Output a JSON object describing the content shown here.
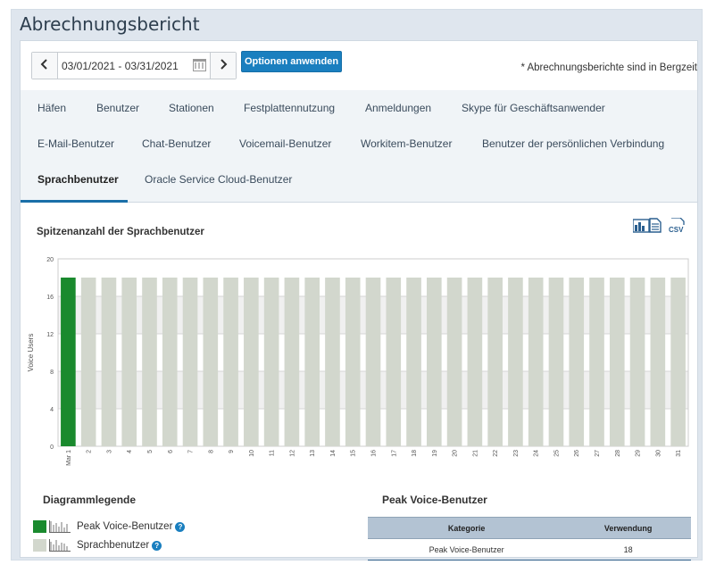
{
  "page": {
    "title": "Abrechnungsbericht"
  },
  "toolbar": {
    "date_range": "03/01/2021 - 03/31/2021",
    "prev_label": "‹",
    "next_label": "›",
    "apply_label": "Optionen anwenden",
    "timezone_note": "* Abrechnungsberichte sind in Bergzeit"
  },
  "tabs": [
    {
      "label": "Häfen"
    },
    {
      "label": "Benutzer"
    },
    {
      "label": "Stationen"
    },
    {
      "label": "Festplattennutzung"
    },
    {
      "label": "Anmeldungen"
    },
    {
      "label": "Skype für Geschäftsanwender"
    },
    {
      "label": "E-Mail-Benutzer"
    },
    {
      "label": "Chat-Benutzer"
    },
    {
      "label": "Voicemail-Benutzer"
    },
    {
      "label": "Workitem-Benutzer"
    },
    {
      "label": "Benutzer der persönlichen Verbindung"
    },
    {
      "label": "Sprachbenutzer",
      "active": true
    },
    {
      "label": "Oracle Service Cloud-Benutzer"
    }
  ],
  "chart_section": {
    "title": "Spitzenanzahl der Sprachbenutzer",
    "export_chart_icon": "chart-report-icon",
    "export_csv_icon": "csv-icon",
    "csv_label": "CSV"
  },
  "chart_data": {
    "type": "bar",
    "ylabel": "Voice Users",
    "ylim": [
      0,
      20
    ],
    "yticks": [
      0,
      4,
      8,
      12,
      16,
      20
    ],
    "categories": [
      "Mar 1",
      "2",
      "3",
      "4",
      "5",
      "6",
      "7",
      "8",
      "9",
      "10",
      "11",
      "12",
      "13",
      "14",
      "15",
      "16",
      "17",
      "18",
      "19",
      "20",
      "21",
      "22",
      "23",
      "24",
      "25",
      "26",
      "27",
      "28",
      "29",
      "30",
      "31"
    ],
    "series": [
      {
        "name": "Peak Voice-Benutzer",
        "color": "#1a8a2e",
        "values": [
          18,
          0,
          0,
          0,
          0,
          0,
          0,
          0,
          0,
          0,
          0,
          0,
          0,
          0,
          0,
          0,
          0,
          0,
          0,
          0,
          0,
          0,
          0,
          0,
          0,
          0,
          0,
          0,
          0,
          0,
          0
        ]
      },
      {
        "name": "Sprachbenutzer",
        "color": "#d2d7cd",
        "values": [
          0,
          18,
          18,
          18,
          18,
          18,
          18,
          18,
          18,
          18,
          18,
          18,
          18,
          18,
          18,
          18,
          18,
          18,
          18,
          18,
          18,
          18,
          18,
          18,
          18,
          18,
          18,
          18,
          18,
          18,
          18
        ]
      }
    ],
    "grid": true
  },
  "legend": {
    "title": "Diagrammlegende",
    "items": [
      {
        "label": "Peak Voice-Benutzer",
        "color": "#1a8a2e"
      },
      {
        "label": "Sprachbenutzer",
        "color": "#d2d7cd"
      }
    ],
    "help_label": "?"
  },
  "usage": {
    "title": "Peak Voice-Benutzer",
    "headers": [
      "Kategorie",
      "Verwendung"
    ],
    "rows": [
      [
        "Peak Voice-Benutzer",
        "18"
      ]
    ]
  }
}
